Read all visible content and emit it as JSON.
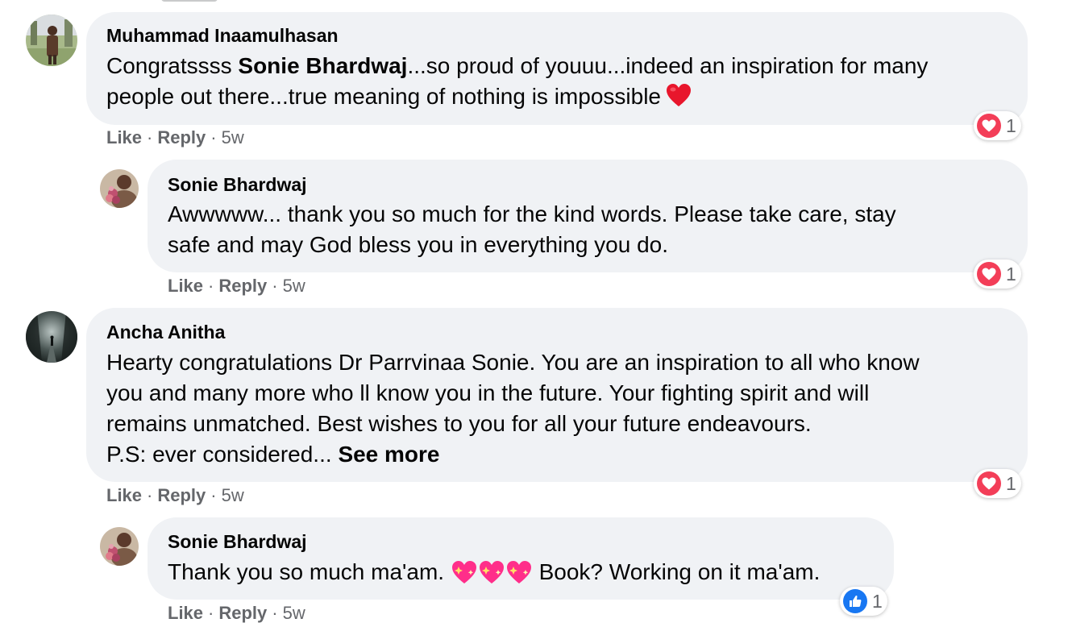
{
  "comments": [
    {
      "author": "Muhammad Inaamulhasan",
      "text_lines": {
        "l1_pre": "Congratssss ",
        "l1_bold": "Sonie Bhardwaj",
        "l1_post": "...so proud of youuu...indeed an inspiration for many",
        "l2": "people out there...true meaning of nothing is impossible"
      },
      "emoji": "red-heart-emoji",
      "actions": {
        "like": "Like",
        "reply": "Reply",
        "time": "5w"
      },
      "reaction": {
        "type": "love",
        "count": "1"
      }
    },
    {
      "author": "Sonie Bhardwaj",
      "text_lines": {
        "l1": "Awwwww... thank you so much for the kind words. Please take care, stay",
        "l2": "safe and may God bless you in everything you do."
      },
      "actions": {
        "like": "Like",
        "reply": "Reply",
        "time": "5w"
      },
      "reaction": {
        "type": "love",
        "count": "1"
      }
    },
    {
      "author": "Ancha Anitha",
      "text_lines": {
        "l1": "Hearty congratulations Dr Parrvinaa Sonie. You are an inspiration to all who know",
        "l2": "you and many more who ll know you in the future. Your fighting spirit and will",
        "l3": "remains unmatched. Best wishes to you for all your future endeavours.",
        "l4_pre": "P.S: ever considered... ",
        "see_more": "See more"
      },
      "actions": {
        "like": "Like",
        "reply": "Reply",
        "time": "5w"
      },
      "reaction": {
        "type": "love",
        "count": "1"
      }
    },
    {
      "author": "Sonie Bhardwaj",
      "text_lines": {
        "l1_pre": "Thank you so much ma'am.",
        "emojis": [
          "sparkling-heart-emoji",
          "sparkling-heart-emoji",
          "sparkling-heart-emoji"
        ],
        "l1_post": "Book? Working on it ma'am."
      },
      "actions": {
        "like": "Like",
        "reply": "Reply",
        "time": "5w"
      },
      "reaction": {
        "type": "like",
        "count": "1"
      }
    }
  ],
  "colors": {
    "bubble": "#f0f2f5",
    "meta_text": "#65676b",
    "love": "#f33e58",
    "like": "#1877f2"
  }
}
